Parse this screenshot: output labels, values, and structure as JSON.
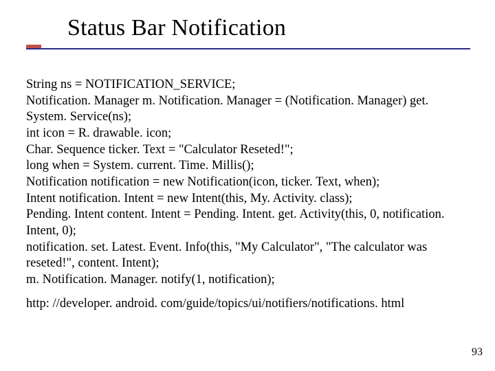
{
  "title": "Status Bar Notification",
  "code_lines": [
    "String ns = NOTIFICATION_SERVICE;",
    "Notification. Manager m. Notification. Manager = (Notification. Manager) get. System. Service(ns);",
    "int icon = R. drawable. icon;",
    "Char. Sequence ticker. Text = \"Calculator Reseted!\";",
    "long when = System. current. Time. Millis();",
    "Notification notification = new Notification(icon, ticker. Text, when);",
    "Intent notification. Intent = new Intent(this, My. Activity. class);",
    "Pending. Intent content. Intent = Pending. Intent. get. Activity(this, 0, notification. Intent, 0);",
    "notification. set. Latest. Event. Info(this, \"My Calculator\", \"The calculator was reseted!\", content. Intent);",
    "m. Notification. Manager. notify(1, notification);"
  ],
  "url": "http: //developer. android. com/guide/topics/ui/notifiers/notifications. html",
  "page_number": "93"
}
